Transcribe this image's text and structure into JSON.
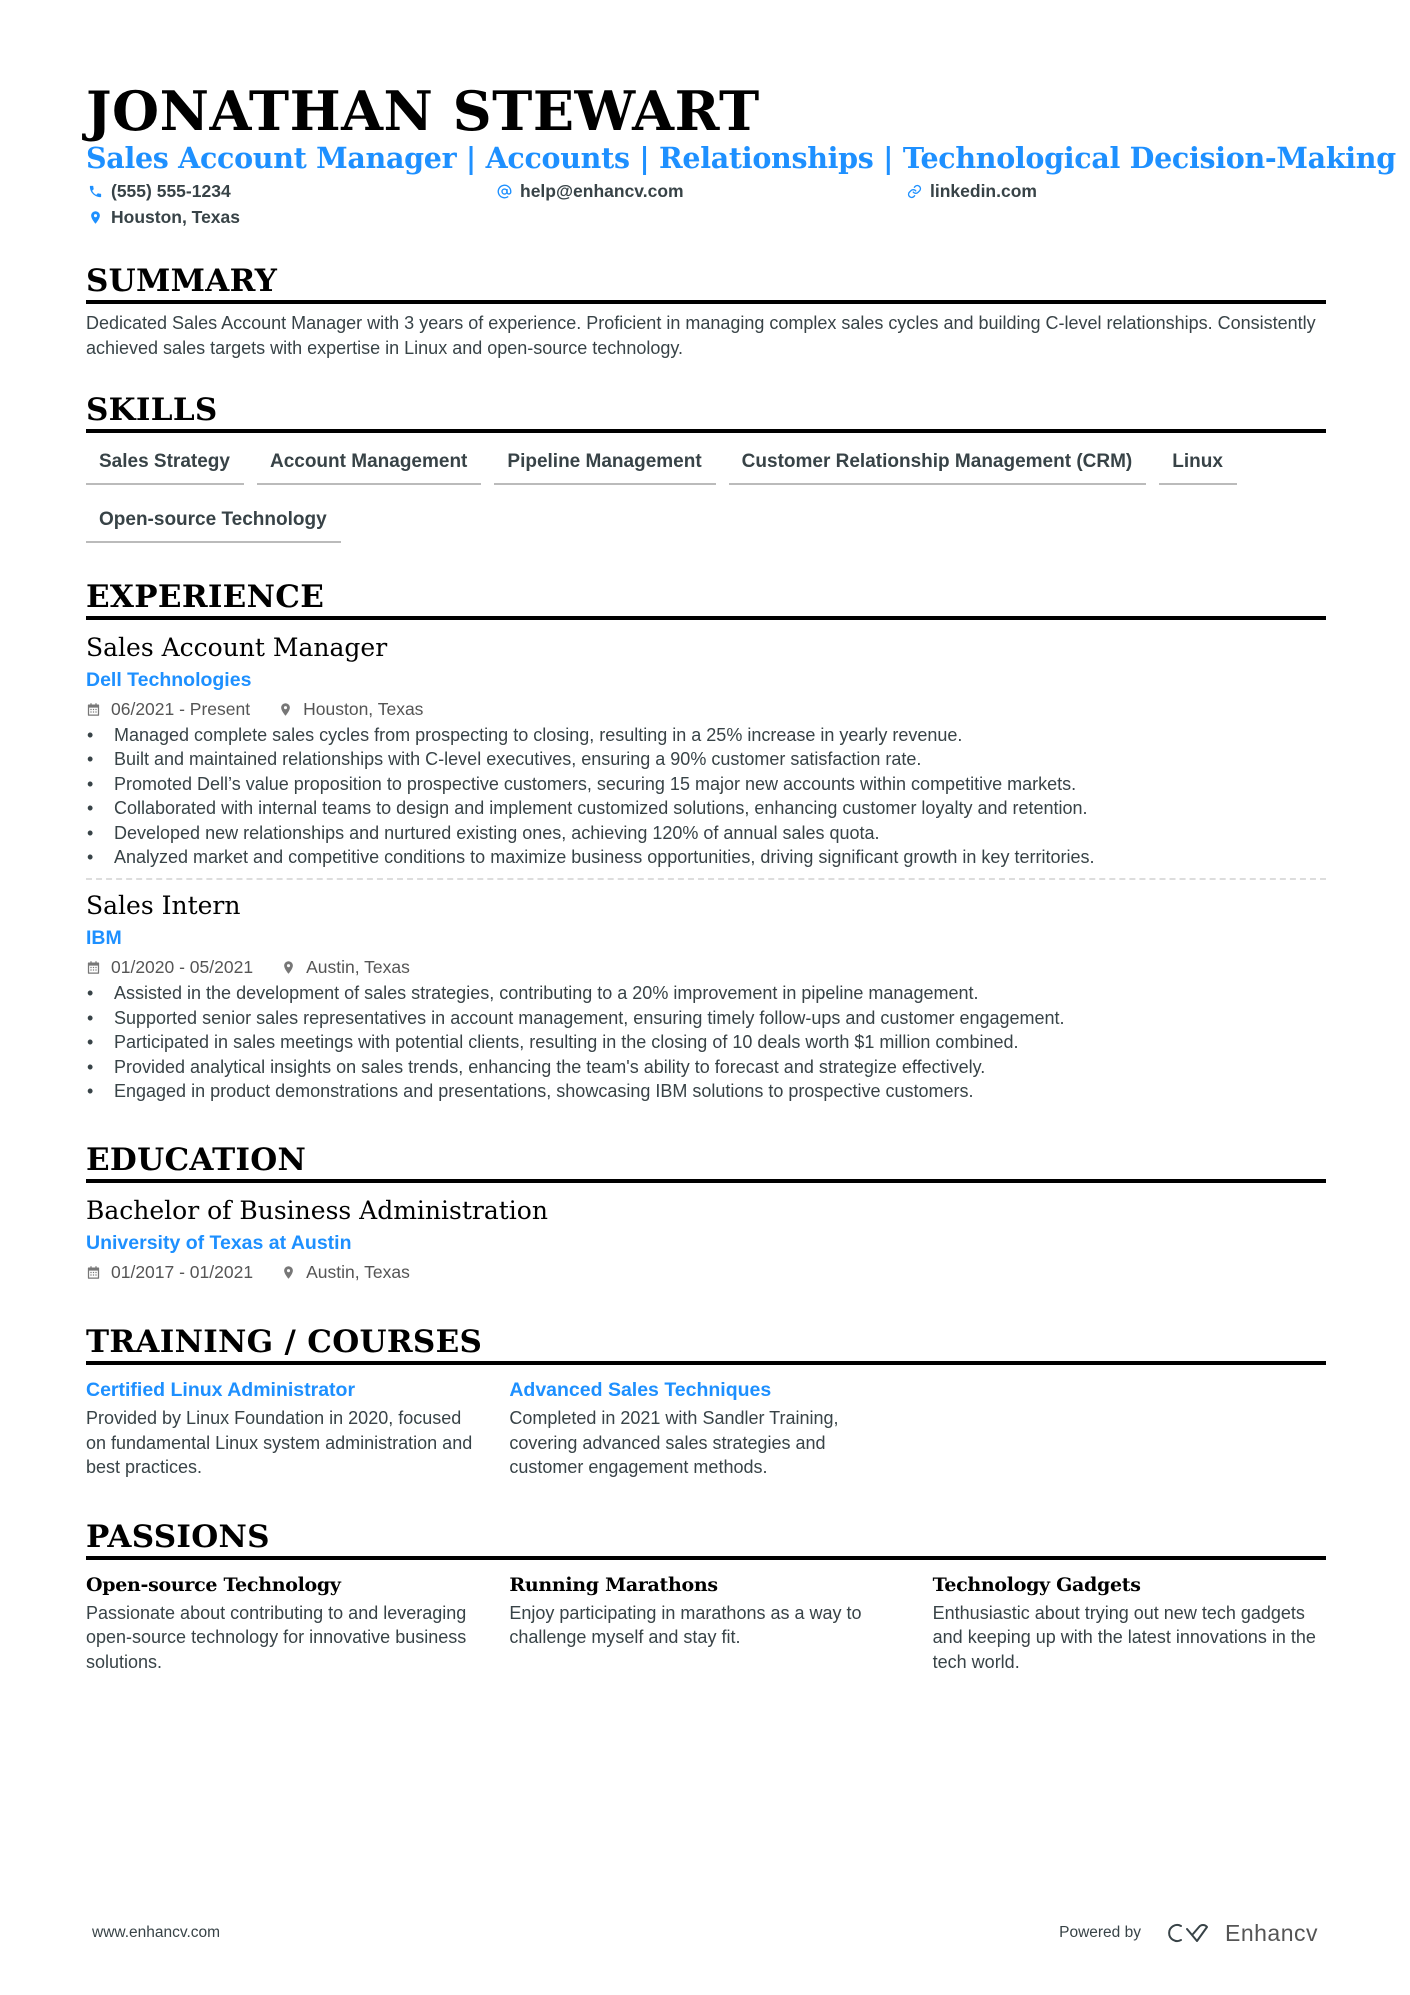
{
  "header": {
    "name": "JONATHAN STEWART",
    "subtitle": "Sales Account Manager | Accounts | Relationships | Technological Decision-Making",
    "contacts": [
      {
        "icon": "phone-icon",
        "text": "(555) 555-1234"
      },
      {
        "icon": "at-icon",
        "text": "help@enhancv.com"
      },
      {
        "icon": "link-icon",
        "text": "linkedin.com"
      },
      {
        "icon": "location-pin-icon",
        "text": "Houston, Texas"
      }
    ]
  },
  "summary": {
    "title": "SUMMARY",
    "text": "Dedicated Sales Account Manager with 3 years of experience. Proficient in managing complex sales cycles and building C-level relationships. Consistently achieved sales targets with expertise in Linux and open-source technology."
  },
  "skills": {
    "title": "SKILLS",
    "items": [
      "Sales Strategy",
      "Account Management",
      "Pipeline Management",
      "Customer Relationship Management (CRM)",
      "Linux",
      "Open-source Technology"
    ]
  },
  "experience": {
    "title": "EXPERIENCE",
    "jobs": [
      {
        "title": "Sales Account Manager",
        "company": "Dell Technologies",
        "dates": "06/2021 - Present",
        "location": "Houston, Texas",
        "bullets": [
          "Managed complete sales cycles from prospecting to closing, resulting in a 25% increase in yearly revenue.",
          "Built and maintained relationships with C-level executives, ensuring a 90% customer satisfaction rate.",
          "Promoted Dell’s value proposition to prospective customers, securing 15 major new accounts within competitive markets.",
          "Collaborated with internal teams to design and implement customized solutions, enhancing customer loyalty and retention.",
          "Developed new relationships and nurtured existing ones, achieving 120% of annual sales quota.",
          "Analyzed market and competitive conditions to maximize business opportunities, driving significant growth in key territories."
        ]
      },
      {
        "title": "Sales Intern",
        "company": "IBM",
        "dates": "01/2020 - 05/2021",
        "location": "Austin, Texas",
        "bullets": [
          "Assisted in the development of sales strategies, contributing to a 20% improvement in pipeline management.",
          "Supported senior sales representatives in account management, ensuring timely follow-ups and customer engagement.",
          "Participated in sales meetings with potential clients, resulting in the closing of 10 deals worth $1 million combined.",
          "Provided analytical insights on sales trends, enhancing the team's ability to forecast and strategize effectively.",
          "Engaged in product demonstrations and presentations, showcasing IBM solutions to prospective customers."
        ]
      }
    ]
  },
  "education": {
    "title": "EDUCATION",
    "degree": "Bachelor of Business Administration",
    "school": "University of Texas at Austin",
    "dates": "01/2017 - 01/2021",
    "location": "Austin, Texas"
  },
  "training": {
    "title": "TRAINING / COURSES",
    "items": [
      {
        "title": "Certified Linux Administrator",
        "text": "Provided by Linux Foundation in 2020, focused on fundamental Linux system administration and best practices."
      },
      {
        "title": "Advanced Sales Techniques",
        "text": "Completed in 2021 with Sandler Training, covering advanced sales strategies and customer engagement methods."
      }
    ]
  },
  "passions": {
    "title": "PASSIONS",
    "items": [
      {
        "title": "Open-source Technology",
        "text": "Passionate about contributing to and leveraging open-source technology for innovative business solutions."
      },
      {
        "title": "Running Marathons",
        "text": "Enjoy participating in marathons as a way to challenge myself and stay fit."
      },
      {
        "title": "Technology Gadgets",
        "text": "Enthusiastic about trying out new tech gadgets and keeping up with the latest innovations in the tech world."
      }
    ]
  },
  "footer": {
    "website": "www.enhancv.com",
    "powered_by": "Powered by",
    "brand": "Enhancv"
  },
  "colors": {
    "accent": "#1e90ff",
    "text": "#384347",
    "heading": "#000000"
  }
}
